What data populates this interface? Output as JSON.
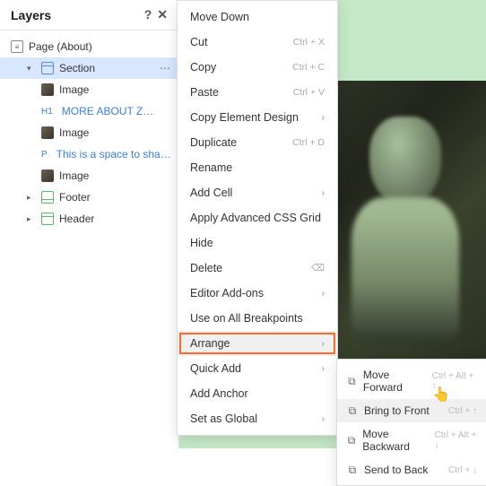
{
  "panel": {
    "title": "Layers"
  },
  "tree": {
    "page_label": "Page (About)",
    "section_label": "Section",
    "children": [
      {
        "label": "Image",
        "type": "thumb"
      },
      {
        "label": "MORE ABOUT Z…",
        "type": "h1"
      },
      {
        "label": "Image",
        "type": "thumb"
      },
      {
        "label": "This is a space to sha…",
        "type": "p"
      },
      {
        "label": "Image",
        "type": "thumb"
      }
    ],
    "footer_label": "Footer",
    "header_label": "Header"
  },
  "menu": {
    "items": [
      {
        "label": "Move Down",
        "shortcut": ""
      },
      {
        "label": "Cut",
        "shortcut": "Ctrl + X"
      },
      {
        "label": "Copy",
        "shortcut": "Ctrl + C"
      },
      {
        "label": "Paste",
        "shortcut": "Ctrl + V"
      },
      {
        "label": "Copy Element Design",
        "sub": true
      },
      {
        "label": "Duplicate",
        "shortcut": "Ctrl + D"
      },
      {
        "label": "Rename",
        "shortcut": ""
      },
      {
        "label": "Add Cell",
        "sub": true
      },
      {
        "label": "Apply Advanced CSS Grid",
        "shortcut": ""
      },
      {
        "label": "Hide",
        "shortcut": ""
      },
      {
        "label": "Delete",
        "shortcut": "⌫"
      },
      {
        "label": "Editor Add-ons",
        "sub": true
      },
      {
        "label": "Use on All Breakpoints",
        "shortcut": ""
      },
      {
        "label": "Arrange",
        "sub": true,
        "highlight": "arrange"
      },
      {
        "label": "Quick Add",
        "sub": true
      },
      {
        "label": "Add Anchor",
        "shortcut": ""
      },
      {
        "label": "Set as Global",
        "sub": true
      }
    ]
  },
  "submenu": {
    "items": [
      {
        "label": "Move Forward",
        "shortcut": "Ctrl + Alt + ↑"
      },
      {
        "label": "Bring to Front",
        "shortcut": "Ctrl + ↑",
        "hover": true
      },
      {
        "label": "Move Backward",
        "shortcut": "Ctrl + Alt + ↓"
      },
      {
        "label": "Send to Back",
        "shortcut": "Ctrl + ↓"
      }
    ]
  }
}
